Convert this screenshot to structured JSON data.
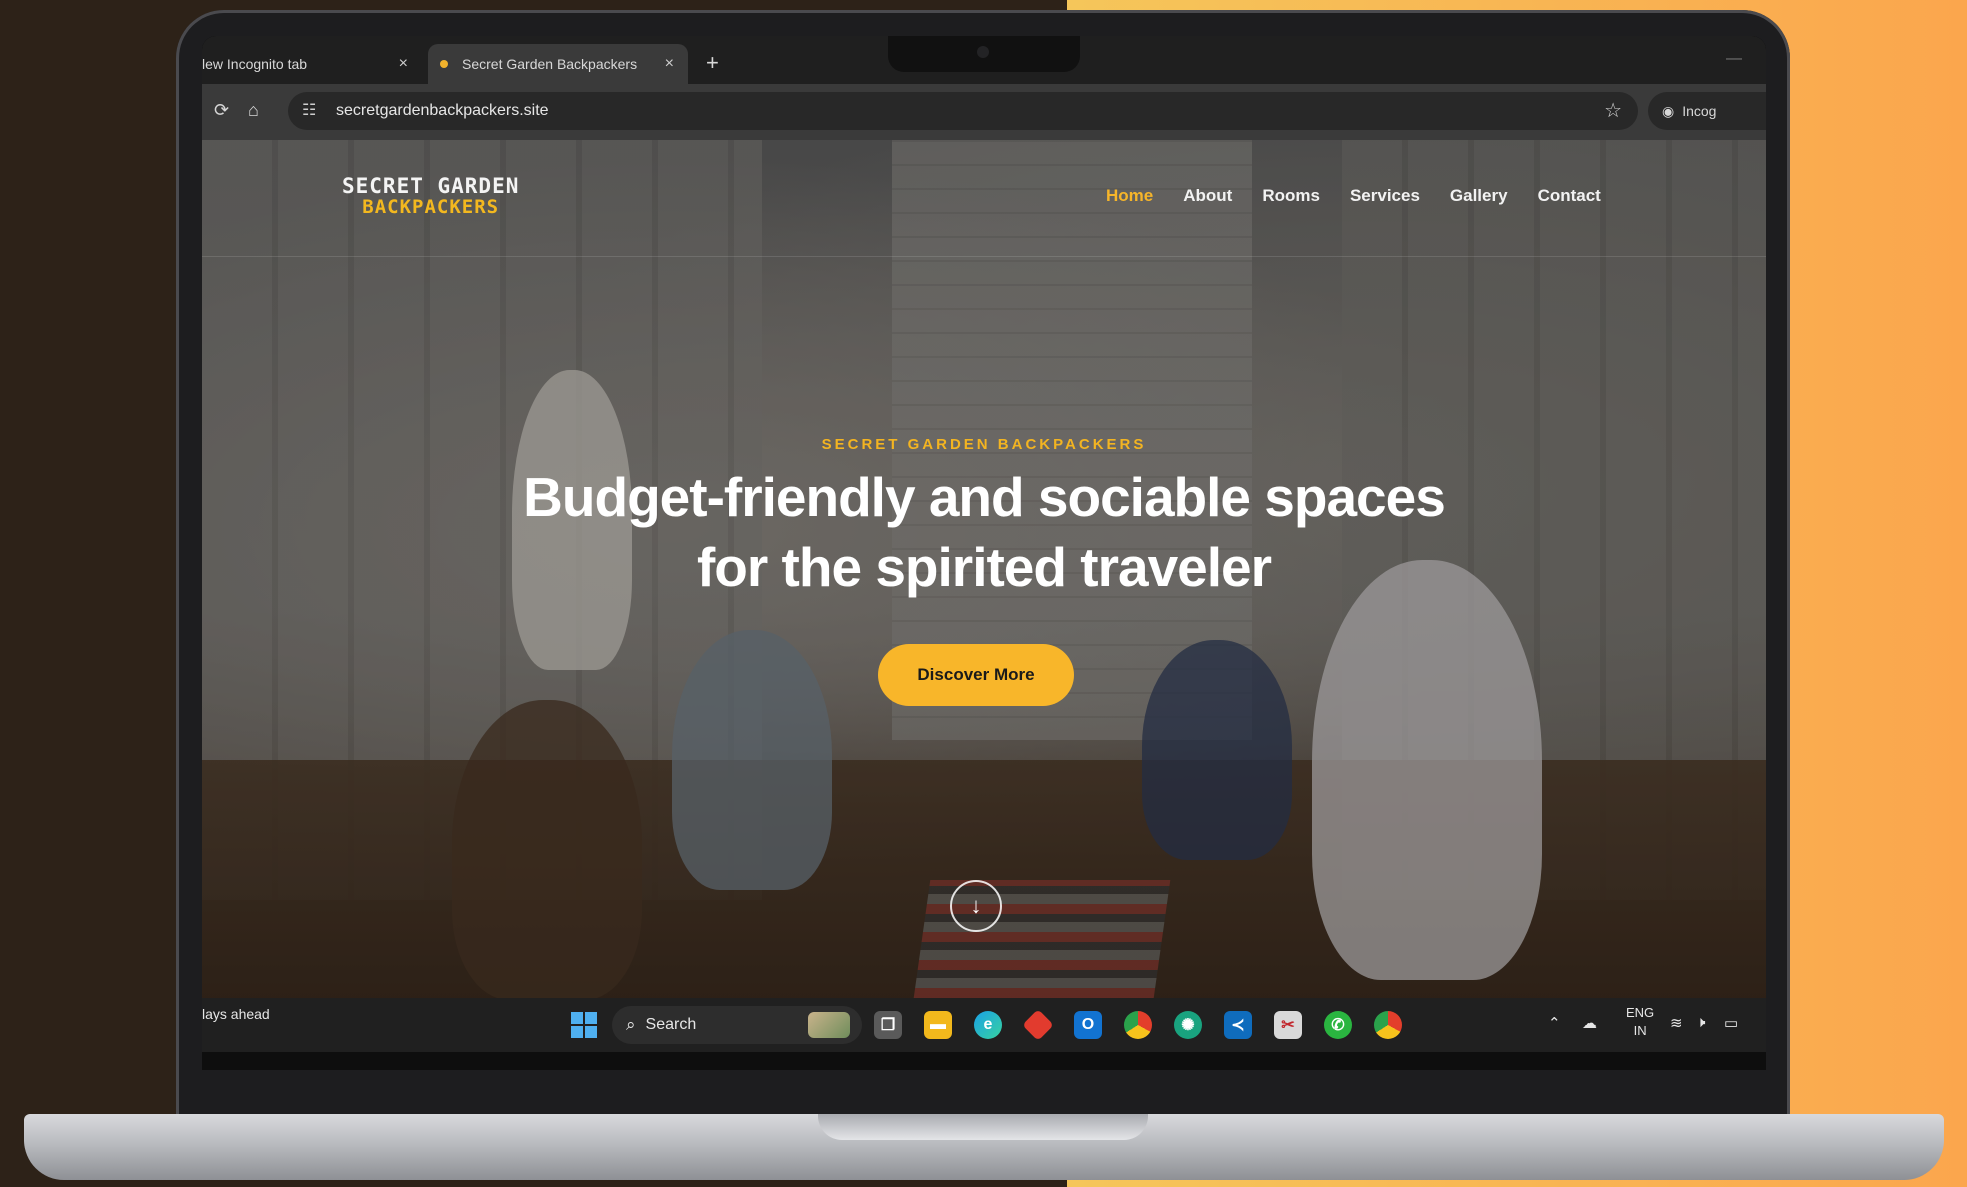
{
  "browser": {
    "tabs": [
      {
        "label": "lew Incognito tab",
        "active": false
      },
      {
        "label": "Secret Garden Backpackers",
        "active": true
      }
    ],
    "new_tab_symbol": "+",
    "close_symbol": "×",
    "minimize_symbol": "—",
    "url": "secretgardenbackpackers.site",
    "incognito_label": "Incog"
  },
  "site": {
    "logo": {
      "line1": "SECRET GARDEN",
      "line2": "BACKPACKERS"
    },
    "nav": [
      {
        "label": "Home",
        "active": true
      },
      {
        "label": "About"
      },
      {
        "label": "Rooms"
      },
      {
        "label": "Services"
      },
      {
        "label": "Gallery"
      },
      {
        "label": "Contact"
      }
    ],
    "hero": {
      "eyebrow": "SECRET GARDEN BACKPACKERS",
      "headline_line1": "Budget-friendly and sociable spaces",
      "headline_line2": "for the spirited traveler",
      "cta": "Discover More",
      "scroll_icon": "↓"
    }
  },
  "taskbar": {
    "left_text": "lays ahead",
    "search_label": "Search",
    "lang_line1": "ENG",
    "lang_line2": "IN",
    "apps": [
      "task-view",
      "file-explorer",
      "edge",
      "app-red",
      "outlook",
      "chrome",
      "chatgpt",
      "vscode",
      "snipping",
      "whatsapp",
      "chrome-alt"
    ]
  },
  "colors": {
    "accent": "#f8b62a",
    "nav_active": "#f6b52a",
    "background_dark": "#2d2218",
    "background_orange": "#f9a74c"
  }
}
